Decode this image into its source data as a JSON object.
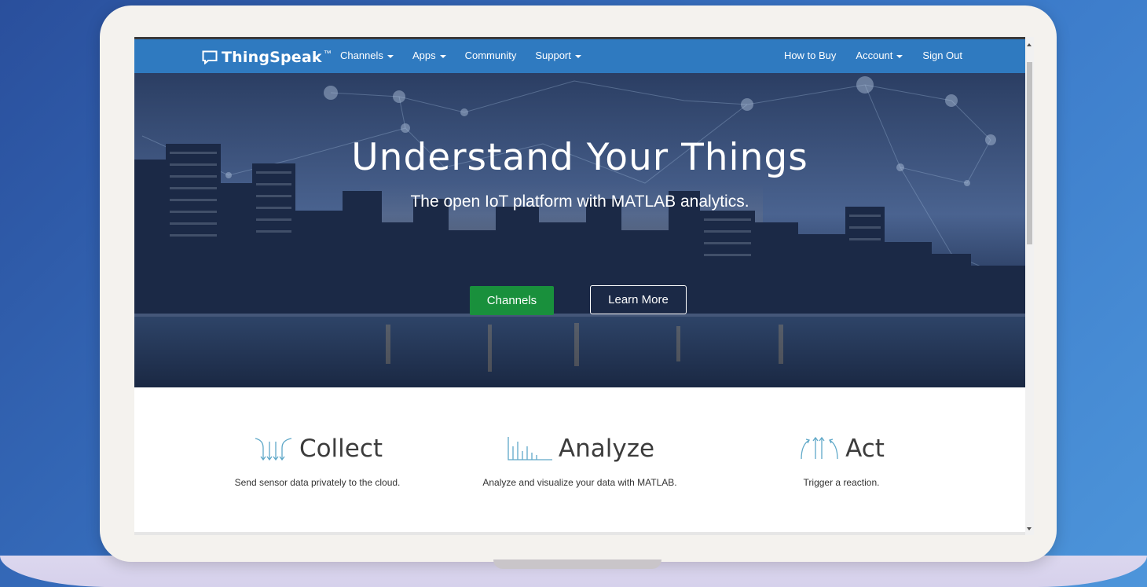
{
  "navbar": {
    "brand": "ThingSpeak",
    "brand_tm": "™",
    "left_items": [
      {
        "label": "Channels",
        "dropdown": true
      },
      {
        "label": "Apps",
        "dropdown": true
      },
      {
        "label": "Community",
        "dropdown": false
      },
      {
        "label": "Support",
        "dropdown": true
      }
    ],
    "right_items": [
      {
        "label": "How to Buy",
        "dropdown": false
      },
      {
        "label": "Account",
        "dropdown": true
      },
      {
        "label": "Sign Out",
        "dropdown": false
      }
    ]
  },
  "hero": {
    "title": "Understand Your Things",
    "subtitle": "The open IoT platform with MATLAB analytics.",
    "primary_button": "Channels",
    "secondary_button": "Learn More"
  },
  "features": [
    {
      "title": "Collect",
      "description": "Send sensor data privately to the cloud.",
      "icon": "collect-icon"
    },
    {
      "title": "Analyze",
      "description": "Analyze and visualize your data with MATLAB.",
      "icon": "analyze-icon"
    },
    {
      "title": "Act",
      "description": "Trigger a reaction.",
      "icon": "act-icon"
    }
  ],
  "colors": {
    "navbar": "#2f7ac0",
    "primary_button": "#19903c",
    "background": "#3a78c8"
  }
}
